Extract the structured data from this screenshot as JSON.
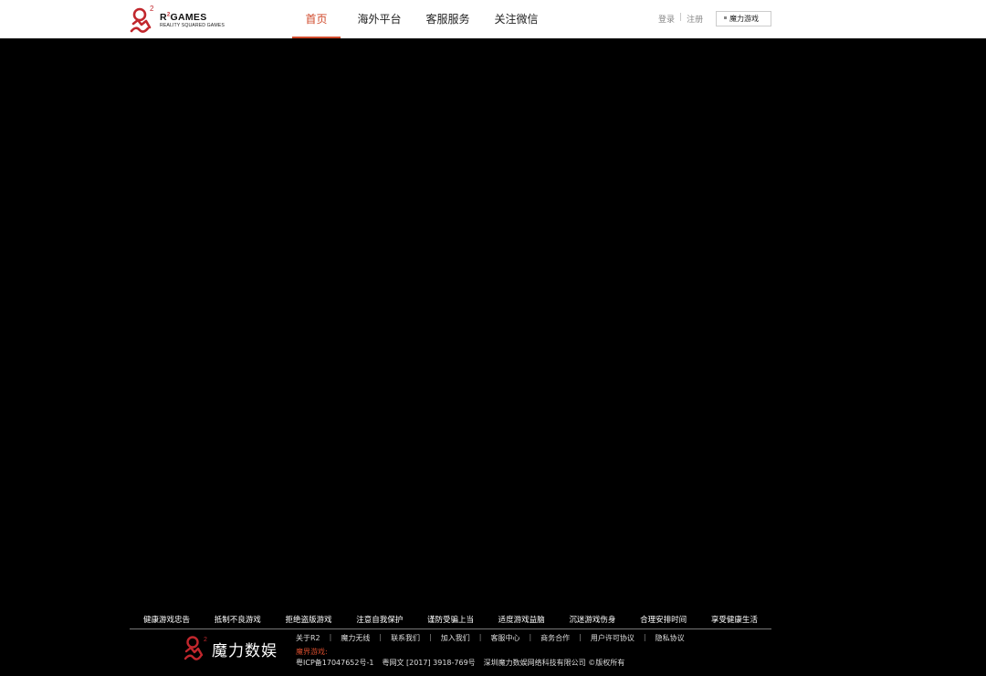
{
  "header": {
    "logo": {
      "brand_prefix": "R",
      "brand_sup": "2",
      "brand_suffix": "GAMES",
      "tagline": "REALITY SQUARED GAMES"
    },
    "nav": [
      {
        "label": "首页",
        "active": true
      },
      {
        "label": "海外平台",
        "active": false
      },
      {
        "label": "客服服务",
        "active": false
      },
      {
        "label": "关注微信",
        "active": false
      }
    ],
    "auth": {
      "login": "登录",
      "separator": "|",
      "register": "注册"
    },
    "game_button": "魔力游戏"
  },
  "footer": {
    "health_tips": [
      "健康游戏忠告",
      "抵制不良游戏",
      "拒绝盗版游戏",
      "注意自我保护",
      "谨防受骗上当",
      "适度游戏益脑",
      "沉迷游戏伤身",
      "合理安排时间",
      "享受健康生活"
    ],
    "company_logo_text": "魔力数娱",
    "links": [
      "关于R2",
      "魔力无线",
      "联系我们",
      "加入我们",
      "客服中心",
      "商务合作",
      "用户许可协议",
      "隐私协议"
    ],
    "link_separator": "|",
    "label": "魔界游戏:",
    "icp": "粤ICP备17047652号-1",
    "culture": "粤网文 [2017] 3918-769号",
    "copyright": "深圳魔力数娱网络科技有限公司 ©版权所有"
  },
  "colors": {
    "accent": "#d04a2b",
    "logo_red": "#c1272d",
    "background": "#000000"
  }
}
